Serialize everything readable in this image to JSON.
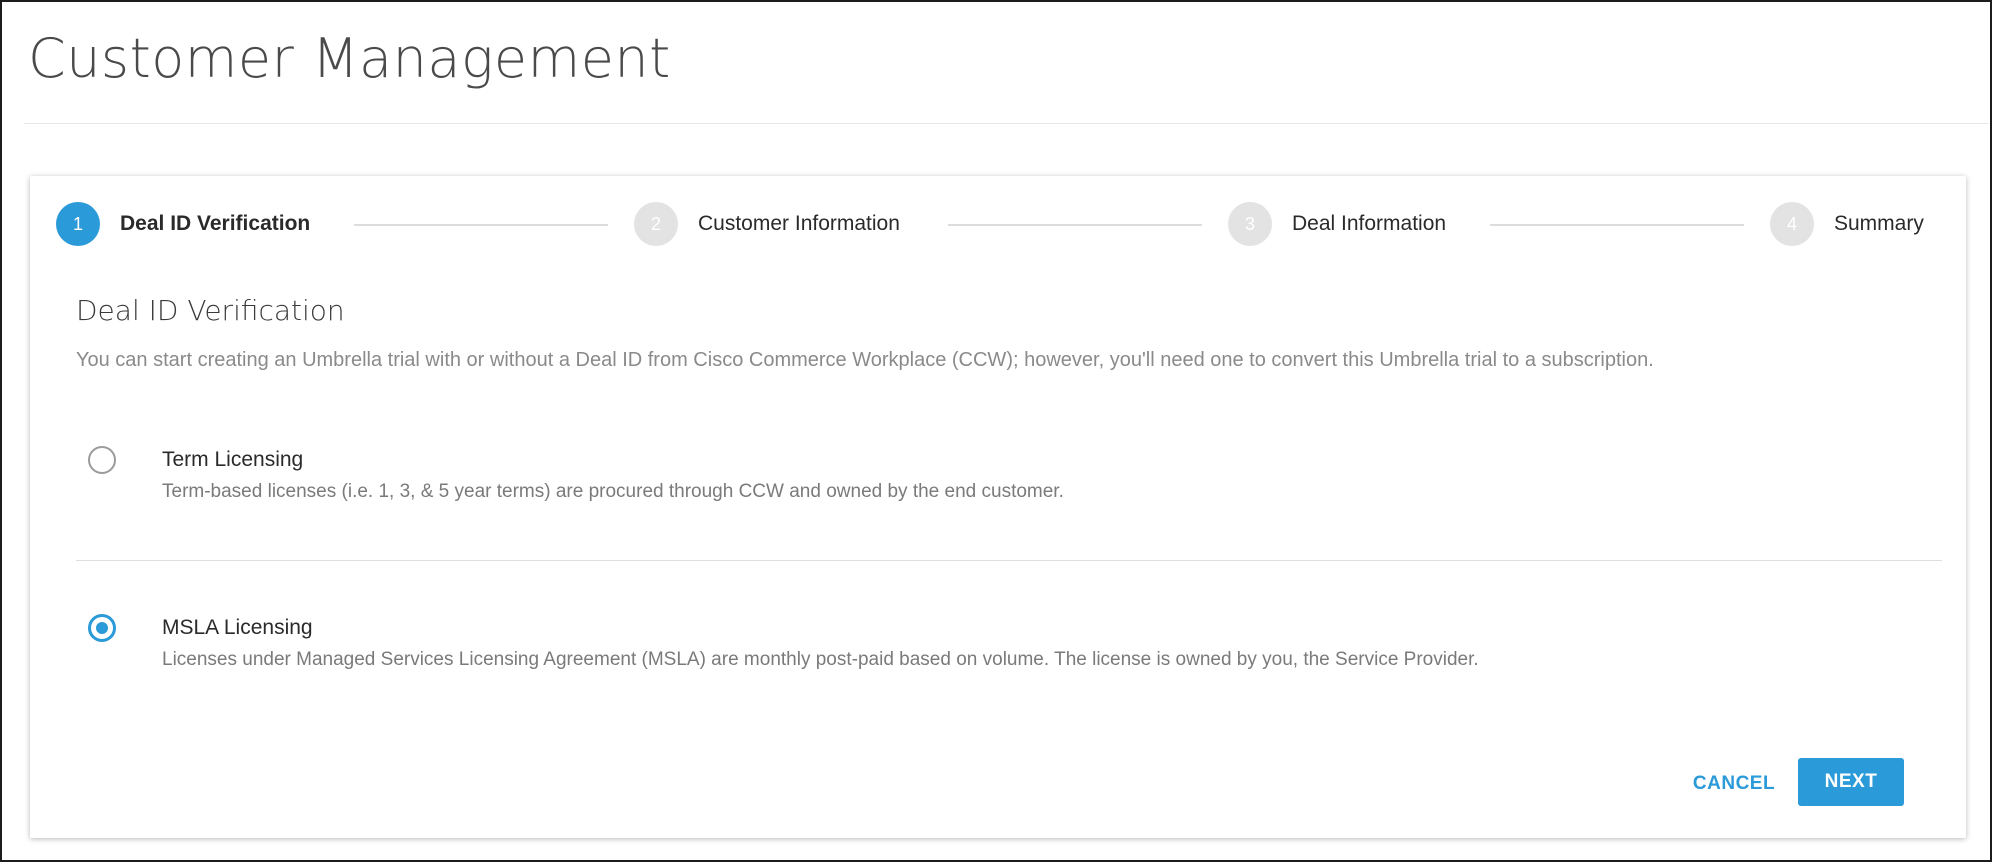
{
  "page": {
    "title": "Customer Management"
  },
  "stepper": {
    "steps": [
      {
        "number": "1",
        "label": "Deal ID Verification",
        "state": "active"
      },
      {
        "number": "2",
        "label": "Customer Information",
        "state": "inactive"
      },
      {
        "number": "3",
        "label": "Deal Information",
        "state": "inactive"
      },
      {
        "number": "4",
        "label": "Summary",
        "state": "inactive"
      }
    ]
  },
  "section": {
    "title": "Deal ID Verification",
    "description": "You can start creating an Umbrella trial with or without a Deal ID from Cisco Commerce Workplace (CCW); however, you'll need one to convert this Umbrella trial to a subscription."
  },
  "options": [
    {
      "title": "Term Licensing",
      "description": "Term-based licenses (i.e. 1, 3, & 5 year terms) are procured through CCW and owned by the end customer.",
      "selected": false
    },
    {
      "title": "MSLA Licensing",
      "description": "Licenses under Managed Services Licensing Agreement (MSLA) are monthly post-paid based on volume. The license is owned by you, the Service Provider.",
      "selected": true
    }
  ],
  "actions": {
    "cancel_label": "CANCEL",
    "next_label": "NEXT"
  },
  "colors": {
    "accent": "#2b9ad9",
    "inactive_step": "#e3e3e3",
    "text_dark": "#2a2a2a",
    "text_muted": "#8a8a8a"
  }
}
